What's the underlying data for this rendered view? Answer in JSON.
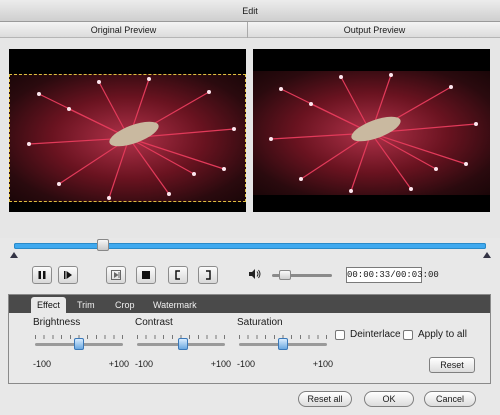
{
  "window": {
    "title": "Edit"
  },
  "previews": {
    "original_label": "Original Preview",
    "output_label": "Output Preview"
  },
  "player": {
    "progress_fraction": 0.18,
    "time_display": "00:00:33/00:03:00",
    "volume_fraction": 0.15
  },
  "tabs": [
    {
      "label": "Effect",
      "active": true
    },
    {
      "label": "Trim"
    },
    {
      "label": "Crop"
    },
    {
      "label": "Watermark"
    }
  ],
  "effect": {
    "brightness": {
      "label": "Brightness",
      "min": "-100",
      "max": "+100",
      "value_fraction": 0.5
    },
    "contrast": {
      "label": "Contrast",
      "min": "-100",
      "max": "+100",
      "value_fraction": 0.52
    },
    "saturation": {
      "label": "Saturation",
      "min": "-100",
      "max": "+100",
      "value_fraction": 0.5
    },
    "deinterlace_label": "Deinterlace",
    "apply_all_label": "Apply to all",
    "reset_label": "Reset"
  },
  "footer": {
    "reset_all_label": "Reset all",
    "ok_label": "OK",
    "cancel_label": "Cancel"
  },
  "colors": {
    "accent": "#3fa9ef",
    "tabbar": "#4a4a4a"
  },
  "icons": [
    "pause-icon",
    "play-step-icon",
    "frame-step-icon",
    "stop-icon",
    "mark-in-icon",
    "mark-out-icon",
    "volume-icon"
  ]
}
